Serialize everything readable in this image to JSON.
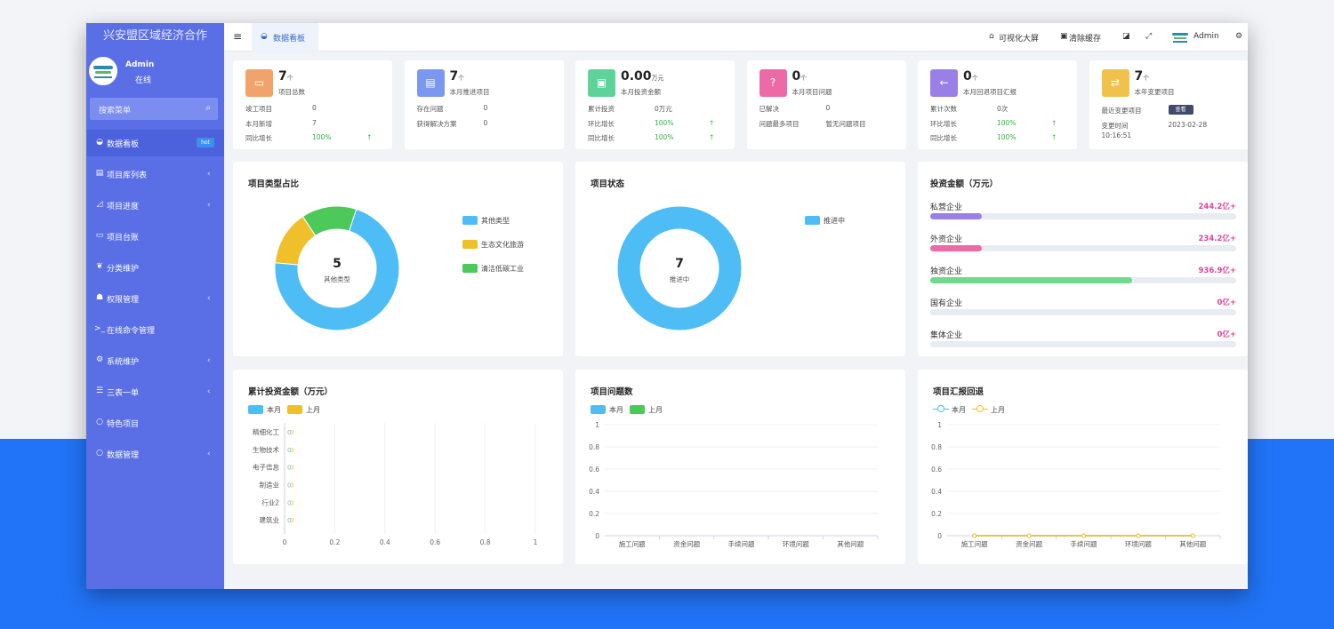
{
  "app": {
    "title": "兴安盟区域经济合作"
  },
  "user": {
    "name": "Admin",
    "status": "在线"
  },
  "search": {
    "placeholder": "搜索菜单"
  },
  "sidebar": {
    "items": [
      {
        "label": "数据看板",
        "icon": "dashboard-icon",
        "glyph": "◒",
        "badge": "hot",
        "active": true
      },
      {
        "label": "项目库列表",
        "icon": "database-icon",
        "glyph": "▤",
        "arrow": "‹"
      },
      {
        "label": "项目进度",
        "icon": "chart-icon",
        "glyph": "◿",
        "arrow": "‹"
      },
      {
        "label": "项目台账",
        "icon": "book-icon",
        "glyph": "▭"
      },
      {
        "label": "分类维护",
        "icon": "leaf-icon",
        "glyph": "❦"
      },
      {
        "label": "权限管理",
        "icon": "users-icon",
        "glyph": "☗",
        "arrow": "‹"
      },
      {
        "label": "在线命令管理",
        "icon": "terminal-icon",
        "glyph": ">_"
      },
      {
        "label": "系统维护",
        "icon": "gears-icon",
        "glyph": "⚙",
        "arrow": "‹"
      },
      {
        "label": "三表一单",
        "icon": "list-icon",
        "glyph": "☰",
        "arrow": "‹"
      },
      {
        "label": "特色项目",
        "icon": "circle-icon",
        "glyph": "○"
      },
      {
        "label": "数据管理",
        "icon": "circle-icon",
        "glyph": "○",
        "arrow": "‹"
      }
    ]
  },
  "topbar": {
    "tab": "数据看板",
    "visual_screen": "可视化大屏",
    "clear_cache": "清除缓存",
    "user": "Admin"
  },
  "stats": [
    {
      "value": "7",
      "unit": "个",
      "label": "项目总数",
      "color": "#f0a46b",
      "rows": [
        [
          "竣工项目",
          "0",
          ""
        ],
        [
          "本月新增",
          "7",
          ""
        ],
        [
          "同比增长",
          "100%",
          "↑"
        ]
      ]
    },
    {
      "value": "7",
      "unit": "个",
      "label": "本月推进项目",
      "color": "#7a98ef",
      "rows": [
        [
          "存在问题",
          "0",
          ""
        ],
        [
          "获得解决方案",
          "0",
          ""
        ]
      ]
    },
    {
      "value": "0.00",
      "unit": "万元",
      "label": "本月投资金额",
      "color": "#5dd39a",
      "rows": [
        [
          "累计投资",
          "0万元",
          ""
        ],
        [
          "环比增长",
          "100%",
          "↑"
        ],
        [
          "同比增长",
          "100%",
          "↑"
        ]
      ]
    },
    {
      "value": "0",
      "unit": "个",
      "label": "本月项目问题",
      "color": "#ee6aa6",
      "rows": [
        [
          "已解决",
          "0",
          ""
        ],
        [
          "问题最多项目",
          "暂无问题项目",
          ""
        ]
      ]
    },
    {
      "value": "0",
      "unit": "个",
      "label": "本月回退项目汇报",
      "color": "#9a7fe6",
      "rows": [
        [
          "累计次数",
          "0次",
          ""
        ],
        [
          "环比增长",
          "100%",
          "↑"
        ],
        [
          "同比增长",
          "100%",
          "↑"
        ]
      ]
    },
    {
      "value": "7",
      "unit": "个",
      "label": "本年变更项目",
      "color": "#f0c24b",
      "recent_label": "最近变更项目",
      "view_btn": "查看",
      "time_label": "变更时间",
      "time_value": "2023-02-28",
      "time_clock": "10:16:51"
    }
  ],
  "type_chart": {
    "title": "项目类型占比",
    "center_value": "5",
    "center_label": "其他类型",
    "legend": [
      {
        "name": "其他类型",
        "color": "#4fbdf5"
      },
      {
        "name": "生态文化旅游",
        "color": "#f0c02a"
      },
      {
        "name": "清洁低碳工业",
        "color": "#4cc95a"
      }
    ]
  },
  "status_chart": {
    "title": "项目状态",
    "center_value": "7",
    "center_label": "推进中",
    "legend": [
      {
        "name": "推进中",
        "color": "#4fbdf5"
      }
    ]
  },
  "investment": {
    "title": "投资金额（万元）",
    "items": [
      {
        "name": "私营企业",
        "value": "244.2亿+",
        "fraction": 0.17,
        "color": "#9a7fe6"
      },
      {
        "name": "外资企业",
        "value": "234.2亿+",
        "fraction": 0.17,
        "color": "#ee6aa6"
      },
      {
        "name": "独资企业",
        "value": "936.9亿+",
        "fraction": 0.66,
        "color": "#6fd98c"
      },
      {
        "name": "国有企业",
        "value": "0亿+",
        "fraction": 0,
        "color": "#6fd98c"
      },
      {
        "name": "集体企业",
        "value": "0亿+",
        "fraction": 0,
        "color": "#6fd98c"
      }
    ]
  },
  "cumulative": {
    "title": "累计投资金额（万元）",
    "legend": [
      {
        "name": "本月",
        "color": "#4fbdf5"
      },
      {
        "name": "上月",
        "color": "#f0c02a"
      }
    ]
  },
  "issues": {
    "title": "项目问题数",
    "legend": [
      {
        "name": "本月",
        "color": "#4fbdf5"
      },
      {
        "name": "上月",
        "color": "#4cc95a"
      }
    ]
  },
  "reports": {
    "title": "项目汇报回退",
    "legend": [
      {
        "name": "本月",
        "color": "#4fbdf5"
      },
      {
        "name": "上月",
        "color": "#f0c02a"
      }
    ]
  },
  "chart_data": [
    {
      "type": "pie",
      "title": "项目类型占比",
      "categories": [
        "其他类型",
        "生态文化旅游",
        "清洁低碳工业"
      ],
      "values": [
        5,
        1,
        1
      ]
    },
    {
      "type": "pie",
      "title": "项目状态",
      "categories": [
        "推进中"
      ],
      "values": [
        7
      ]
    },
    {
      "type": "bar",
      "title": "累计投资金额（万元）",
      "orientation": "horizontal",
      "categories": [
        "精细化工",
        "生物技术",
        "电子信息",
        "制造业",
        "行业2",
        "建筑业"
      ],
      "series": [
        {
          "name": "本月",
          "values": [
            0,
            0,
            0,
            0,
            0,
            0
          ]
        },
        {
          "name": "上月",
          "values": [
            0,
            0,
            0,
            0,
            0,
            0
          ]
        }
      ],
      "xticks": [
        "0",
        "0.2",
        "0.4",
        "0.6",
        "0.8",
        "1"
      ],
      "xlim": [
        0,
        1
      ]
    },
    {
      "type": "bar",
      "title": "项目问题数",
      "categories": [
        "施工问题",
        "资金问题",
        "手续问题",
        "环境问题",
        "其他问题"
      ],
      "series": [
        {
          "name": "本月",
          "values": [
            0,
            0,
            0,
            0,
            0
          ]
        },
        {
          "name": "上月",
          "values": [
            0,
            0,
            0,
            0,
            0
          ]
        }
      ],
      "yticks": [
        "0",
        "0.2",
        "0.4",
        "0.6",
        "0.8",
        "1"
      ],
      "ylim": [
        0,
        1
      ]
    },
    {
      "type": "line",
      "title": "项目汇报回退",
      "categories": [
        "施工问题",
        "资金问题",
        "手续问题",
        "环境问题",
        "其他问题"
      ],
      "series": [
        {
          "name": "本月",
          "values": [
            0,
            0,
            0,
            0,
            0
          ]
        },
        {
          "name": "上月",
          "values": [
            0,
            0,
            0,
            0,
            0
          ]
        }
      ],
      "yticks": [
        "0",
        "0.2",
        "0.4",
        "0.6",
        "0.8",
        "1"
      ],
      "ylim": [
        0,
        1
      ]
    }
  ]
}
